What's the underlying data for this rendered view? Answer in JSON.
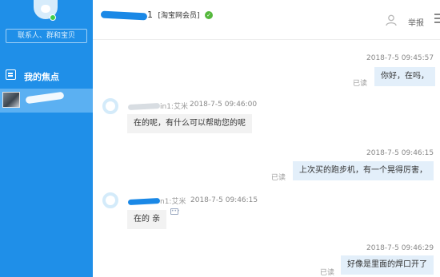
{
  "sidebar": {
    "search_placeholder": "联系人、群和宝贝",
    "focus_label": "我的焦点",
    "colors": {
      "background": "#1f8fe8",
      "selected": "#5bb0f2"
    }
  },
  "header": {
    "title_suffix": "1",
    "badge": "[淘宝网会员]",
    "report_label": "举报"
  },
  "chat": {
    "messages": [
      {
        "from": "me",
        "time": "2018-7-5 09:45:57",
        "text": "你好，在吗，",
        "status": "已读"
      },
      {
        "from": "them",
        "sender_suffix": "in1:艾米",
        "time": "2018-7-5 09:46:00",
        "text": "在的呢，有什么可以帮助您的呢"
      },
      {
        "from": "me",
        "time": "2018-7-5 09:46:15",
        "text": "上次买的跑步机，有一个晃得厉害，",
        "status": "已读"
      },
      {
        "from": "them",
        "sender_suffix": "n1:艾米",
        "time": "2018-7-5 09:46:15",
        "text": "在的 亲"
      },
      {
        "from": "me",
        "time": "2018-7-5 09:46:29",
        "text": "好像是里面的焊口开了",
        "status": "已读"
      }
    ]
  }
}
